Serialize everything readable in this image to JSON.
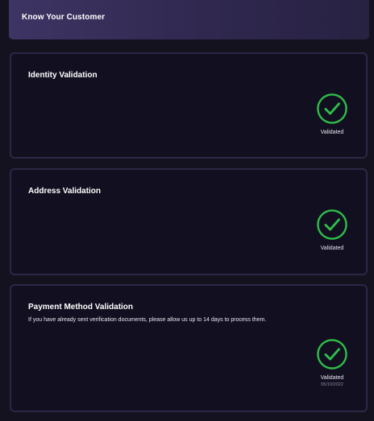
{
  "header": {
    "title": "Know Your Customer"
  },
  "cards": [
    {
      "title": "Identity Validation",
      "status": "Validated",
      "icon": "check-circle-icon"
    },
    {
      "title": "Address Validation",
      "status": "Validated",
      "icon": "check-circle-icon"
    },
    {
      "title": "Payment Method Validation",
      "description": "If you have already sent verification documents, please allow us up to 14 days to process them.",
      "status": "Validated",
      "date": "05/10/2022",
      "icon": "check-circle-icon"
    }
  ],
  "colors": {
    "background": "#15121f",
    "card_background": "#121020",
    "card_border": "#2c2746",
    "header_gradient_start": "#3e3464",
    "success_green": "#2fbf4a"
  }
}
